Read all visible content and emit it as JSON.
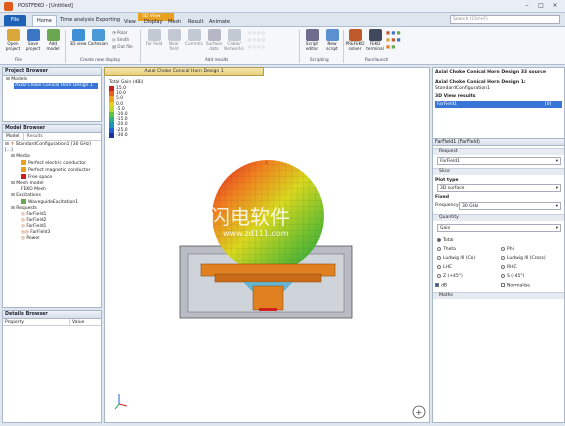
{
  "window": {
    "title": "POSTFEKO - [Untitled]",
    "min": "–",
    "max": "□",
    "close": "×"
  },
  "tabs": {
    "file": "File",
    "home": "Home",
    "time": "Time analysis",
    "exporting": "Exporting",
    "view": "View",
    "display": "Display",
    "mesh": "Mesh",
    "result": "Result",
    "animate": "Animate",
    "context": "3D View"
  },
  "search": {
    "placeholder": "Search (Ctrl+F)"
  },
  "ribbon": {
    "buttons": [
      {
        "label": "Open project",
        "color": "#d9a83a"
      },
      {
        "label": "Save project",
        "color": "#3a76c4"
      },
      {
        "label": "Add model",
        "color": "#6aa84f"
      },
      {
        "label": "3D view",
        "color": "#3d8fd6"
      },
      {
        "label": "Cartesian",
        "color": "#4b9ad8"
      },
      {
        "label": "Surface data",
        "color": "#8a8fa3"
      },
      {
        "label": "Script editor",
        "color": "#6c6c8f"
      },
      {
        "label": "New script",
        "color": "#5a8fd0"
      },
      {
        "label": "PREFEKO solver",
        "color": "#c05a2a"
      },
      {
        "label": "FEKO terminal",
        "color": "#404a5a"
      }
    ],
    "small": [
      "Polar",
      "Smith",
      "Out file"
    ],
    "groups": {
      "file": "File",
      "create": "Create new display",
      "add": "Add results",
      "scripting": "Scripting",
      "run": "Run/launch"
    }
  },
  "project_browser": {
    "title": "Project Browser",
    "root": "Models",
    "item": "Axial Choke Conical Horn Design 1"
  },
  "model_browser": {
    "title": "Model Browser",
    "tab_model": "Model",
    "tab_results": "Results",
    "config": "StandardConfiguration1 [30 GHz] [...]",
    "media": "Media",
    "media_items": [
      {
        "label": "Perfect electric conductor",
        "color": "#e8a020"
      },
      {
        "label": "Perfect magnetic conductor",
        "color": "#e8a020"
      },
      {
        "label": "Free space",
        "color": "#cc2020"
      }
    ],
    "mesh": "Mesh model",
    "mesh_item": "FEKO Mesh",
    "excitations": "Excitations",
    "excitation_item": "WaveguideExcitation1",
    "requests": "Requests",
    "request_items": [
      "FarField1",
      "FarField2",
      "FarField1",
      "FarField3",
      "Power"
    ]
  },
  "details_browser": {
    "title": "Details Browser",
    "col_property": "Property",
    "col_value": "Value"
  },
  "viewport": {
    "tab": "Axial Choke Conical Horn Design 1",
    "legend_title": "Total Gain (dBi)",
    "legend_values": [
      "15.0",
      "10.0",
      "5.0",
      "0.0",
      "-5.0",
      "-10.0",
      "-15.0",
      "-20.0",
      "-25.0",
      "-30.0"
    ],
    "legend_colors": [
      "#c81e1e",
      "#e8601e",
      "#f0a020",
      "#e8d020",
      "#b8d830",
      "#60c040",
      "#30b080",
      "#2090c0",
      "#2060d0",
      "#2030a0"
    ],
    "axis_z": "z",
    "axis_x": "x",
    "axis_y": "y",
    "watermark": "闪电软件",
    "watermark_url": "www.zd111.com"
  },
  "right": {
    "top_title": "Axial Choke Conical Horn Design 33 source",
    "model_label": "Axial Choke Conical Horn Design 1:",
    "config": "StandardConfiguration1",
    "results_label": "3D View results",
    "result_item": "FarField1",
    "result_value": "[0]",
    "ff_header": "FarField1 (FarField)",
    "request_label": "Request",
    "request_value": "FarField1",
    "slice_label": "Slice",
    "plot_type_label": "Plot type",
    "plot_type_value": "3D surface",
    "fixed_label": "Fixed",
    "frequency_label": "Frequency",
    "frequency_value": "30 GHz",
    "quantity_label": "Quantity",
    "quantity_value": "Gain",
    "radios_left": [
      {
        "label": "Total",
        "on": true
      },
      {
        "label": "Theta",
        "on": false
      },
      {
        "label": "Ludwig III (Co)",
        "on": false
      },
      {
        "label": "LHC",
        "on": false
      },
      {
        "label": "Z (+45°)",
        "on": false
      }
    ],
    "radios_right": [
      {
        "label": "Phi",
        "on": false
      },
      {
        "label": "Ludwig III (Cross)",
        "on": false
      },
      {
        "label": "RHC",
        "on": false
      },
      {
        "label": "S (-45°)",
        "on": false
      }
    ],
    "db_label": "dB",
    "normalise_label": "Normalise",
    "maths_label": "Maths"
  }
}
